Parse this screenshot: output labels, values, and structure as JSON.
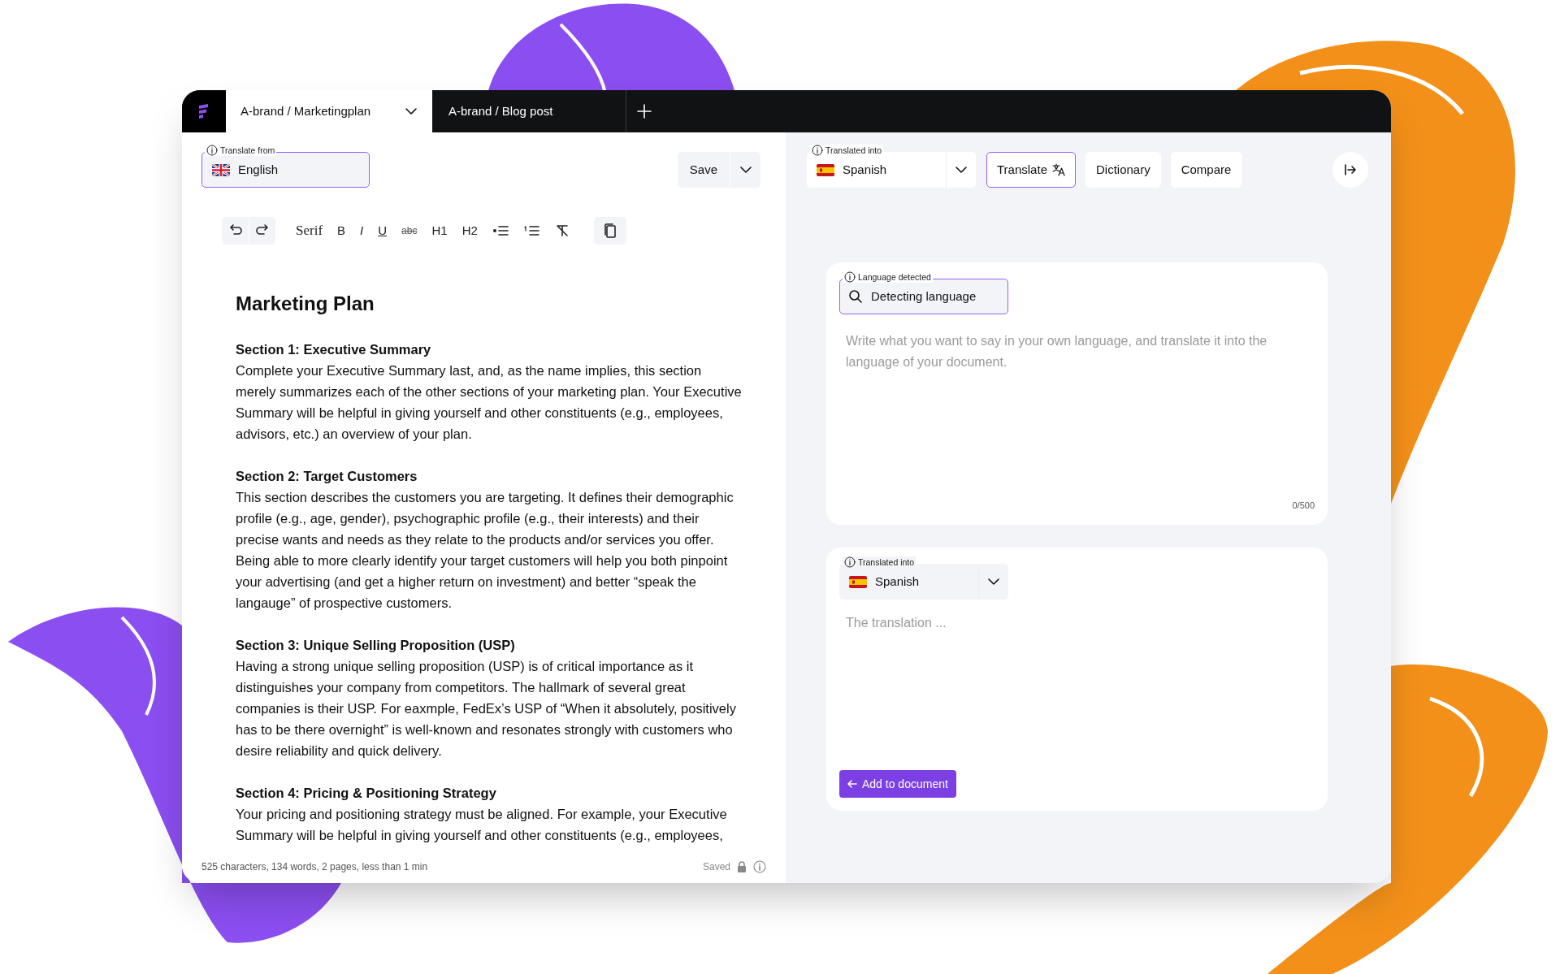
{
  "tabs": [
    {
      "label": "A-brand / Marketingplan",
      "selected": true
    },
    {
      "label": "A-brand / Blog post",
      "selected": false
    }
  ],
  "source_language": {
    "label": "Translate from",
    "value": "English"
  },
  "save_button": "Save",
  "toolbar": [
    {
      "kind": "undo"
    },
    {
      "kind": "redo"
    },
    {
      "kind": "font",
      "label": "Serif"
    },
    {
      "kind": "bold",
      "label": "B"
    },
    {
      "kind": "italic",
      "label": "I"
    },
    {
      "kind": "underline",
      "label": "U"
    },
    {
      "kind": "strike",
      "label": "abc"
    },
    {
      "kind": "heading",
      "label": "H1"
    },
    {
      "kind": "heading",
      "label": "H2"
    },
    {
      "kind": "bullets"
    },
    {
      "kind": "numbers"
    },
    {
      "kind": "clear"
    },
    {
      "kind": "copy"
    }
  ],
  "document": {
    "title": "Marketing Plan",
    "sections": [
      {
        "heading": "Section 1: Executive Summary",
        "body": "Complete your Executive Summary last, and, as the name implies, this section merely summarizes each of the other sections of your marketing plan. Your Executive Summary will be helpful in giving yourself and other constituents (e.g., employees, advisors, etc.) an overview of your plan."
      },
      {
        "heading": "Section 2: Target Customers",
        "body": "This section describes the customers you are targeting. It defines their demographic profile (e.g., age, gender), psychographic profile (e.g., their interests) and their precise wants and needs as they relate to the products and/or services you offer. Being able to more clearly identify your target customers will help you both pinpoint your advertising (and get a higher return on investment) and better “speak the langauge” of prospective customers."
      },
      {
        "heading": "Section 3: Unique Selling Proposition (USP)",
        "body": "Having a strong unique selling proposition (USP) is of critical importance as it distinguishes your company from competitors. The hallmark of several great companies is their USP. For eaxmple, FedEx’s USP of “When it absolutely, positively has to be there overnight” is well-known and resonates strongly with customers who desire reliability and quick delivery."
      },
      {
        "heading": "Section 4: Pricing & Positioning Strategy",
        "body": "Your pricing and positioning strategy must be aligned. For example, your Executive Summary will be helpful in giving yourself and other constituents (e.g., employees,"
      }
    ]
  },
  "status_bar": {
    "stats": "525 characters, 134 words, 2 pages, less than 1 min",
    "save_state": "Saved"
  },
  "target_language": {
    "label": "Translated into",
    "value": "Spanish"
  },
  "actions": [
    {
      "label": "Translate",
      "selected": true
    },
    {
      "label": "Dictionary",
      "selected": false
    },
    {
      "label": "Compare",
      "selected": false
    }
  ],
  "input_card": {
    "label": "Language detected",
    "value": "Detecting language",
    "placeholder": "Write what you want to say in your own language, and translate it into the language of your document.",
    "counter": "0/500"
  },
  "output_card": {
    "label": "Translated into",
    "value": "Spanish",
    "placeholder": "The translation ...",
    "button": "Add to document"
  }
}
